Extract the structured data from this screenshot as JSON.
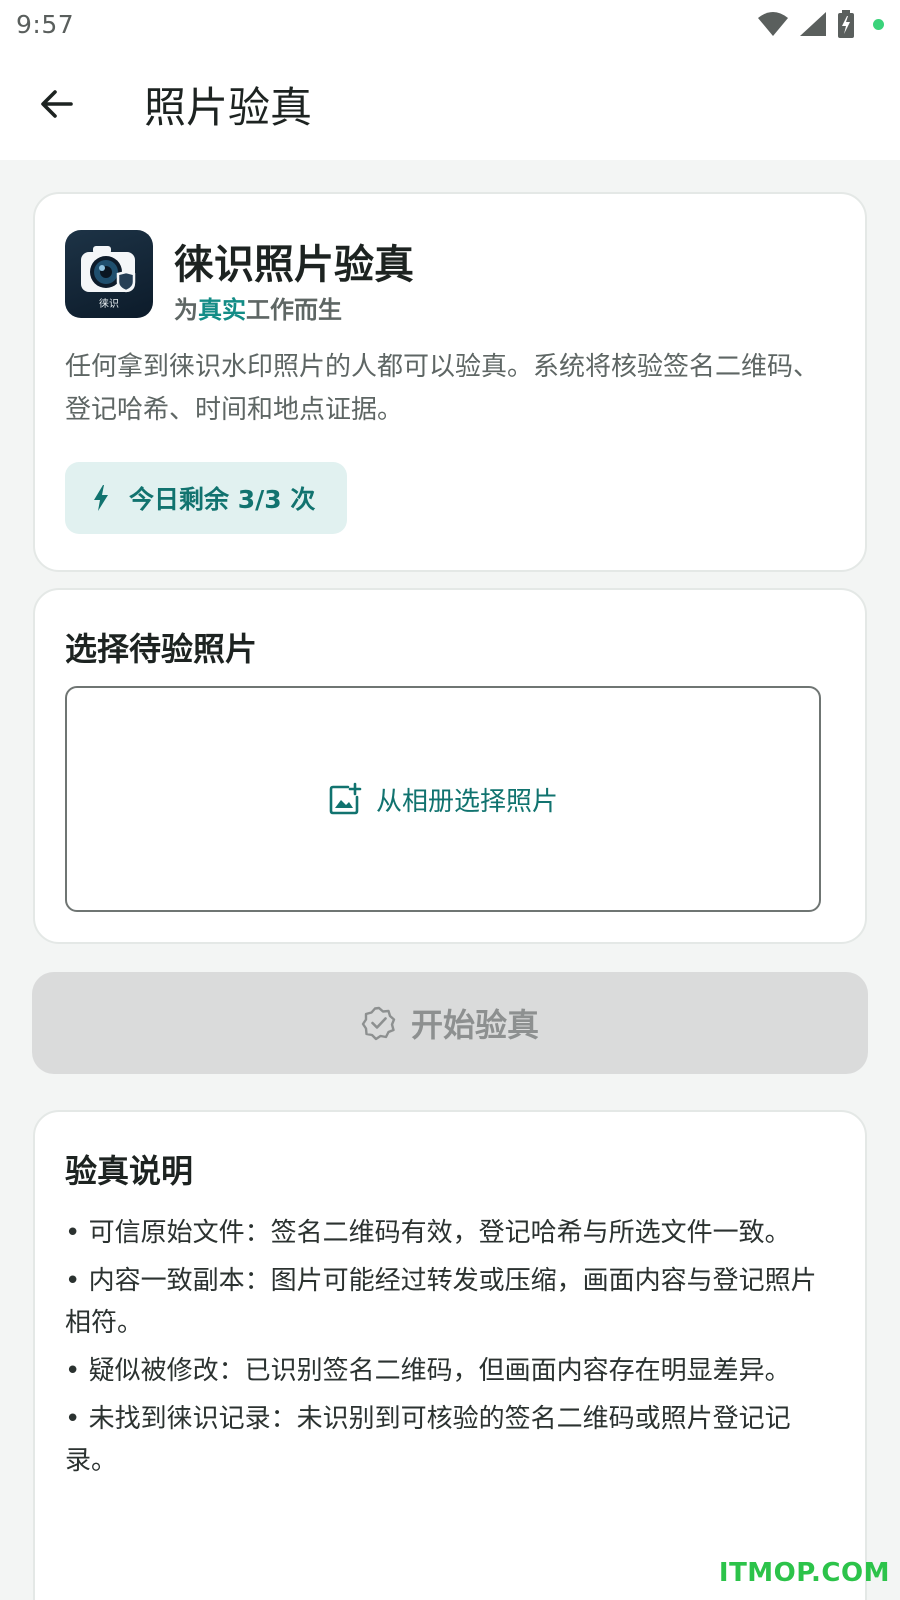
{
  "status_bar": {
    "time": "9:57",
    "icons": [
      "wifi-icon",
      "cell-signal-icon",
      "battery-charging-icon",
      "notification-dot"
    ],
    "dot_color": "#3ad37a"
  },
  "app_bar": {
    "back_icon": "arrow-left-icon",
    "title": "照片验真"
  },
  "intro_card": {
    "app_name": "徕识照片验真",
    "slogan_prefix": "为",
    "slogan_accent": "真实",
    "slogan_suffix": "工作而生",
    "logo_text": "徕识",
    "description": "任何拿到徕识水印照片的人都可以验真。系统将核验签名二维码、登记哈希、时间和地点证据。",
    "quota_icon": "lightning-icon",
    "quota_text": "今日剩余 3/3 次",
    "accent_color": "#138c86"
  },
  "select_card": {
    "title": "选择待验照片",
    "pick_icon": "add-photo-icon",
    "pick_label": "从相册选择照片"
  },
  "start_button": {
    "icon": "verified-badge-icon",
    "label": "开始验真",
    "enabled": false
  },
  "notes_card": {
    "title": "验真说明",
    "items": [
      "• 可信原始文件：签名二维码有效，登记哈希与所选文件一致。",
      "• 内容一致副本：图片可能经过转发或压缩，画面内容与登记照片相符。",
      "• 疑似被修改：已识别签名二维码，但画面内容存在明显差异。",
      "• 未找到徕识记录：未识别到可核验的签名二维码或照片登记记录。"
    ]
  },
  "watermark": "ITMOP.COM"
}
